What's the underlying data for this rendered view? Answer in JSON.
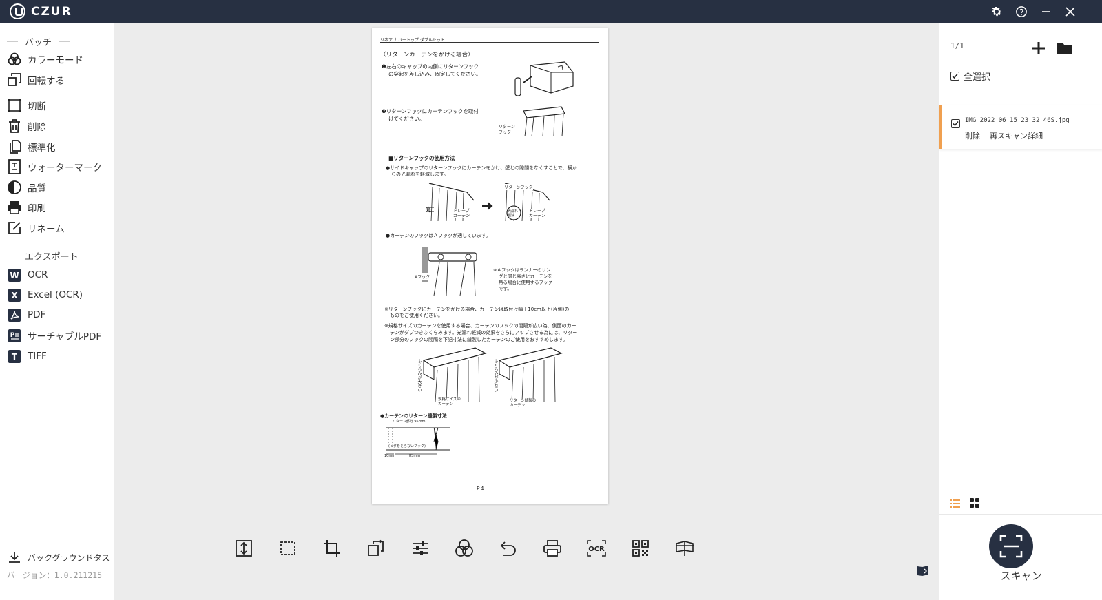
{
  "app": {
    "brand": "CZUR"
  },
  "sidebar": {
    "batch_header": "バッチ",
    "batch_items": [
      {
        "label": "カラーモード",
        "icon": "color-mode-icon"
      },
      {
        "label": "回転する",
        "icon": "rotate-icon"
      },
      {
        "label": "切断",
        "icon": "crop-icon"
      },
      {
        "label": "削除",
        "icon": "trash-icon"
      },
      {
        "label": "標準化",
        "icon": "standardize-icon"
      },
      {
        "label": "ウォーターマーク",
        "icon": "watermark-icon"
      },
      {
        "label": "品質",
        "icon": "quality-icon"
      },
      {
        "label": "印刷",
        "icon": "print-icon"
      },
      {
        "label": "リネーム",
        "icon": "rename-icon"
      }
    ],
    "export_header": "エクスポート",
    "export_items": [
      {
        "label": "OCR",
        "icon": "word-icon"
      },
      {
        "label": "Excel (OCR)",
        "icon": "excel-icon"
      },
      {
        "label": "PDF",
        "icon": "pdf-icon"
      },
      {
        "label": "サーチャブルPDF",
        "icon": "searchable-pdf-icon"
      },
      {
        "label": "TIFF",
        "icon": "tiff-icon"
      }
    ],
    "background_task": "バックグラウンドタス",
    "version": "バージョン：1.0.211215"
  },
  "right_panel": {
    "counter": "1/1",
    "select_all": "全選択",
    "file": {
      "name": "IMG_2022_06_15_23_32_46S.jpg",
      "delete": "削除",
      "rescan": "再スキャン",
      "details": "詳細"
    },
    "scan_label": "スキャン"
  },
  "document": {
    "header": "リネア カバートップ ダブルセット",
    "heading": "〈リターンカーテンをかける場合〉",
    "step1": [
      "❶左右のキャップの内側にリターンフック",
      "の突起を差し込み、固定してください。"
    ],
    "step2": [
      "❷リターンフックにカーテンフックを取付",
      "けてください。"
    ],
    "label_return_hook": "リターン\nフック",
    "section_usage": "■リターンフックの使用方法",
    "usage_text": [
      "●サイドキャップのリターンフックにカーテンをかけ、壁との隙間をなくすことで、横か",
      "らの光漏れを軽減します。"
    ],
    "fig_light": "光",
    "fig_drape": "ドレープ\nカーテン",
    "fig_return_hook": "リターンフック",
    "fig_reduce": "光漏れ\n軽減",
    "hook_a_note": "●カーテンのフックはＡフックが適しています。",
    "hook_a_label": "Aフック",
    "hook_a_desc": [
      "※Ａフックはランナーのリン",
      "グと同じ高さにカーテンを",
      "吊る場合に使用するフック",
      "です。"
    ],
    "note1": [
      "※リターンフックにカーテンをかける場合、カーテンは取付け幅＋10cm以上(片側)の",
      "ものをご使用ください。"
    ],
    "note2": [
      "※規格サイズのカーテンを使用する場合、カーテンのフックの間隔が広い為、側面のカー",
      "テンがダブつきふくらみます。光漏れ軽減の効果をさらにアップさせる為には、リター",
      "ン部分のフックの間隔を下記寸法に縫製したカーテンのご使用をおすすめします。"
    ],
    "fig_bulge": "ふくらみが大きい",
    "fig_std": "規格サイズの\nカーテン",
    "fig_bulge_small": "ふくらみが少ない",
    "fig_sewn": "リターン縫製の\nカーテン",
    "sewing_heading": "●カーテンのリターン縫製寸法",
    "sewing_label": "リターン部分 95mm",
    "sewing_hook": "(ヒダをとらないフック)",
    "dim1": "10mm",
    "dim2": "85mm",
    "page_no": "P.4"
  },
  "toolbar_icons": [
    "fit-height-icon",
    "select-area-icon",
    "crop-tool-icon",
    "rotate-tool-icon",
    "adjust-icon",
    "color-tool-icon",
    "undo-icon",
    "print-tool-icon",
    "ocr-icon",
    "qr-code-icon",
    "book-mode-icon"
  ],
  "ocr_label": "OCR",
  "colors": {
    "titlebar": "#273042",
    "accent": "#f0a050",
    "background": "#ececec"
  }
}
